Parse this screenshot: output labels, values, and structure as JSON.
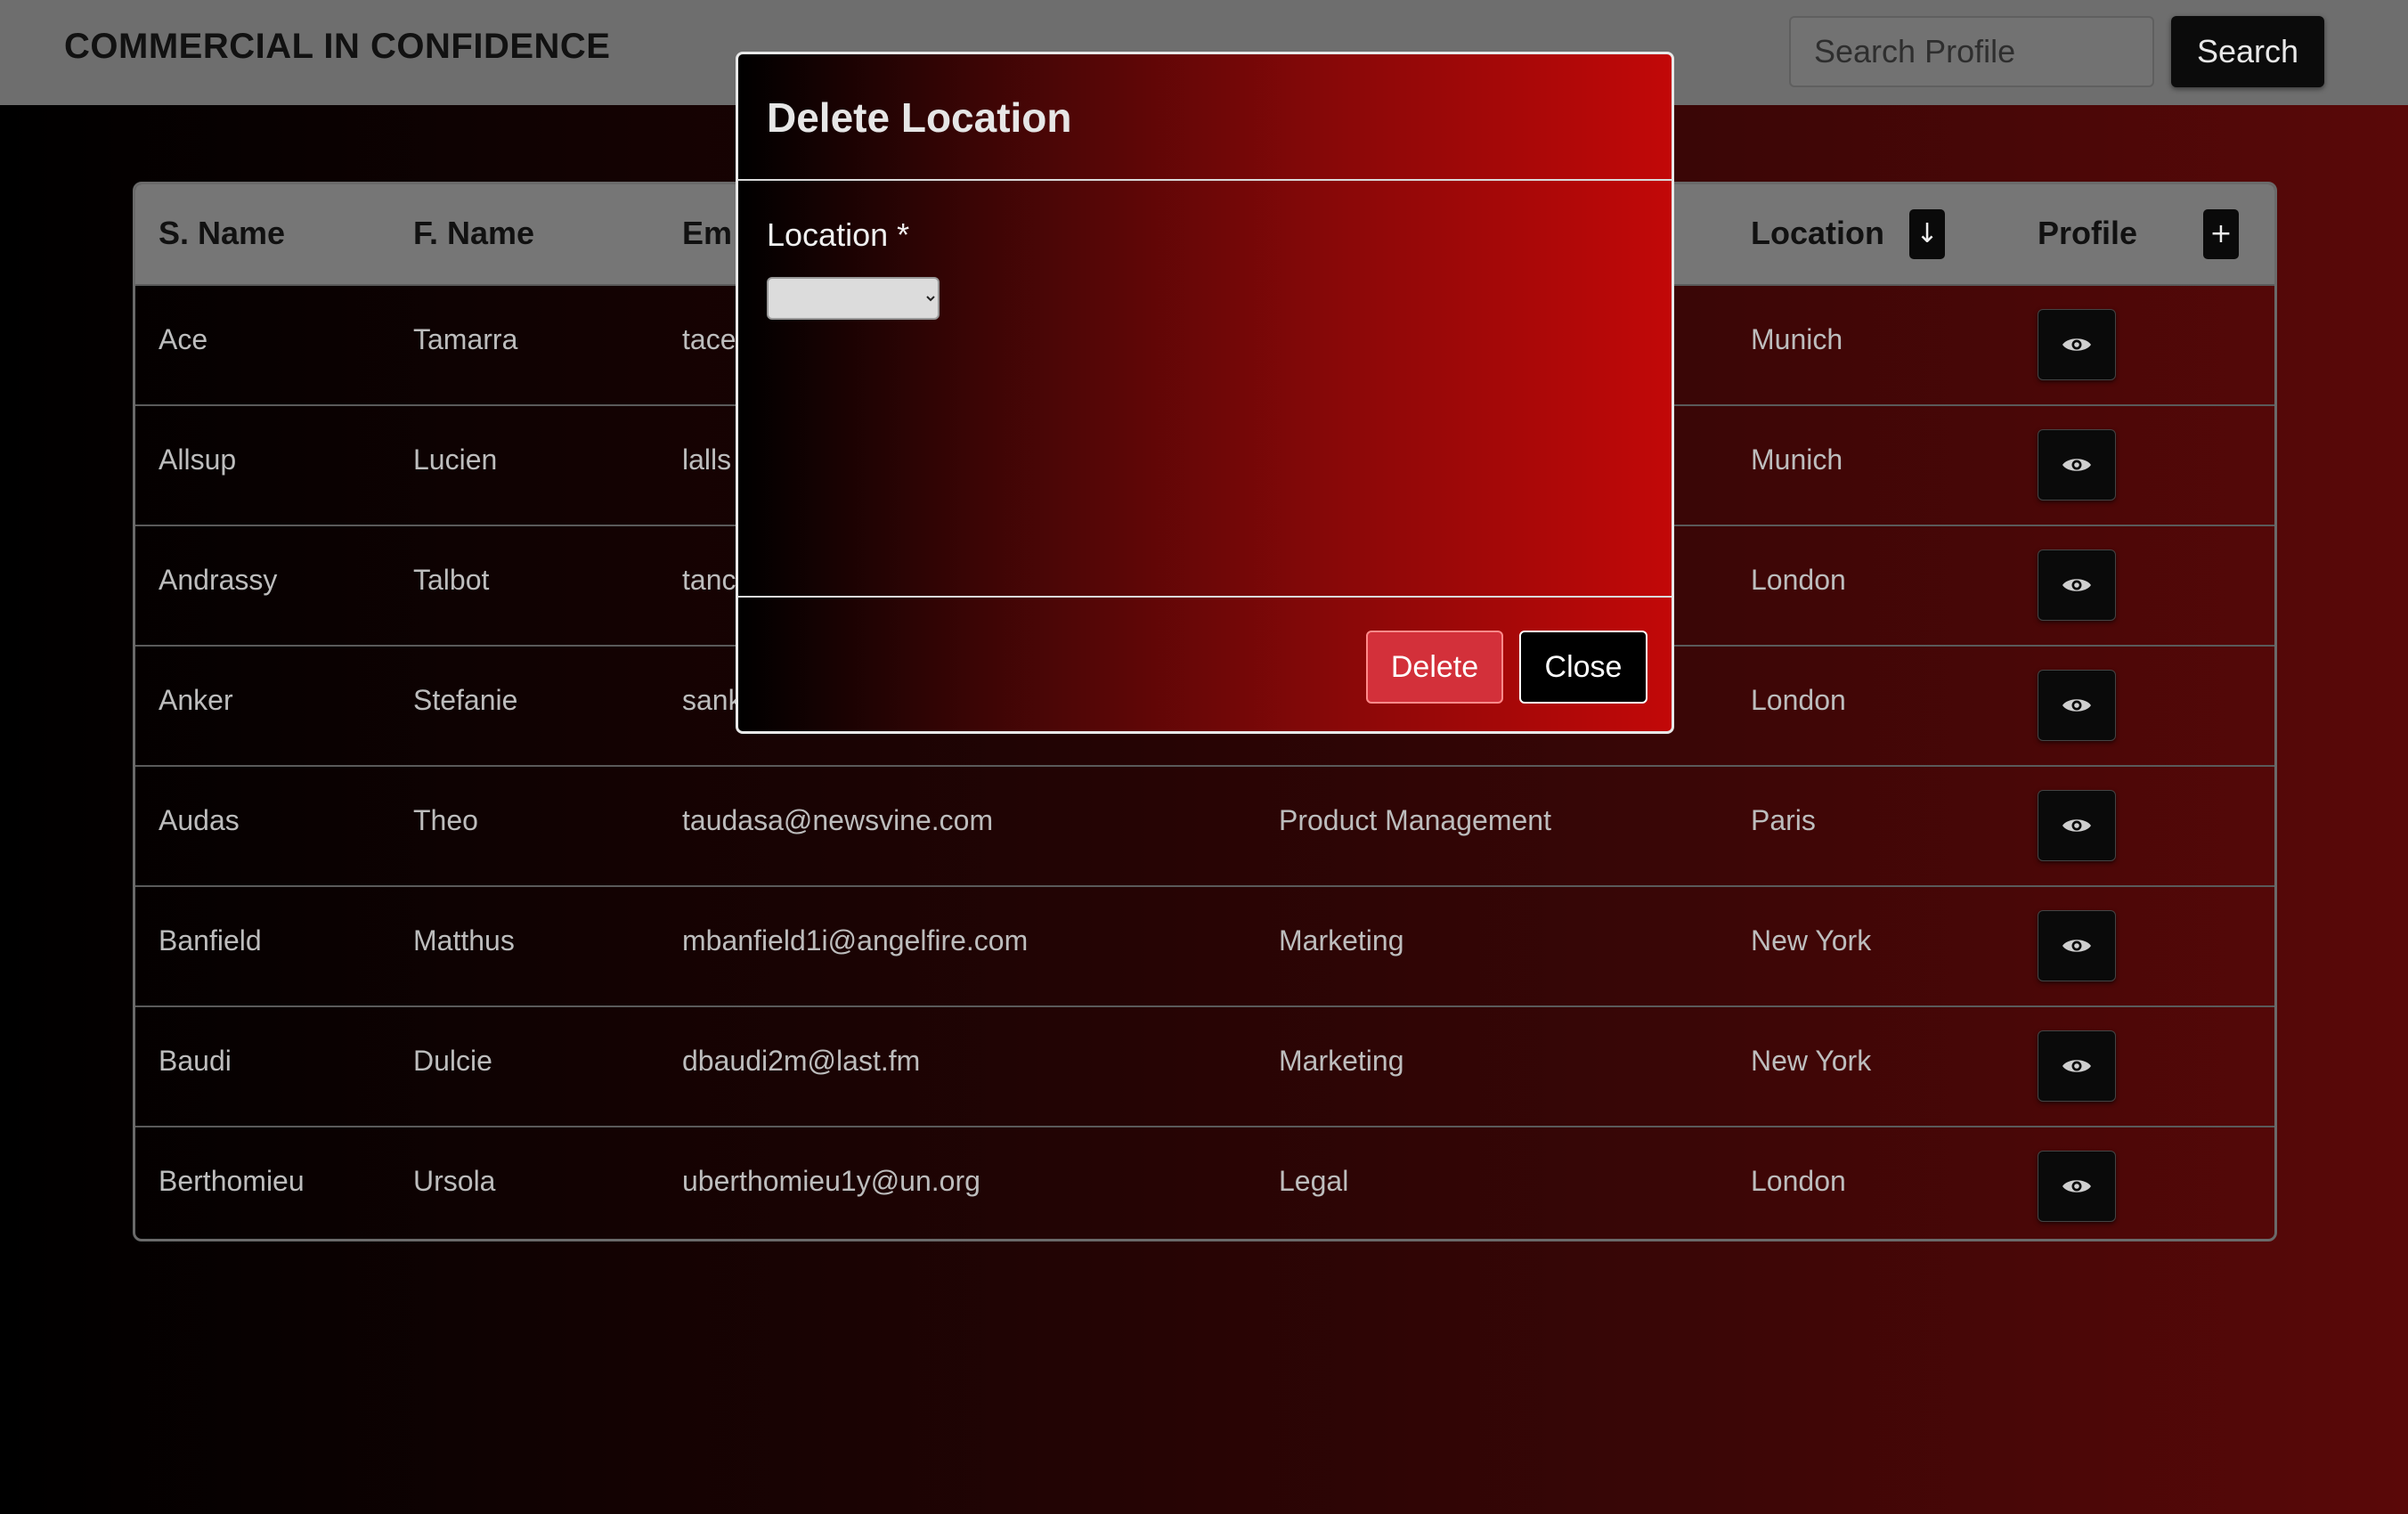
{
  "navbar": {
    "brand": "COMMERCIAL IN CONFIDENCE",
    "search_placeholder": "Search Profile",
    "search_label": "Search"
  },
  "table": {
    "headers": {
      "surname": "S. Name",
      "firstname": "F. Name",
      "email": "Em",
      "location": "Location",
      "profile": "Profile",
      "sort_icon": "↓",
      "add_icon": "+"
    },
    "rows": [
      {
        "surname": "Ace",
        "firstname": "Tamarra",
        "email": "tace",
        "department": "",
        "location": "Munich"
      },
      {
        "surname": "Allsup",
        "firstname": "Lucien",
        "email": "lalls",
        "department": "",
        "location": "Munich"
      },
      {
        "surname": "Andrassy",
        "firstname": "Talbot",
        "email": "tanc",
        "department": "",
        "location": "London"
      },
      {
        "surname": "Anker",
        "firstname": "Stefanie",
        "email": "sank",
        "department": "",
        "location": "London"
      },
      {
        "surname": "Audas",
        "firstname": "Theo",
        "email": "taudasa@newsvine.com",
        "department": "Product Management",
        "location": "Paris"
      },
      {
        "surname": "Banfield",
        "firstname": "Matthus",
        "email": "mbanfield1i@angelfire.com",
        "department": "Marketing",
        "location": "New York"
      },
      {
        "surname": "Baudi",
        "firstname": "Dulcie",
        "email": "dbaudi2m@last.fm",
        "department": "Marketing",
        "location": "New York"
      },
      {
        "surname": "Berthomieu",
        "firstname": "Ursola",
        "email": "uberthomieu1y@un.org",
        "department": "Legal",
        "location": "London"
      }
    ]
  },
  "modal": {
    "title": "Delete Location",
    "field_label": "Location *",
    "select_value": "",
    "delete_label": "Delete",
    "close_label": "Close"
  },
  "icons": {
    "view_profile": "eye-icon",
    "sort": "arrow-down-icon",
    "add": "plus-icon"
  },
  "colors": {
    "delete_button": "#d3303a",
    "navbar": "#6e6e6e",
    "modal_accent": "#c20808"
  }
}
